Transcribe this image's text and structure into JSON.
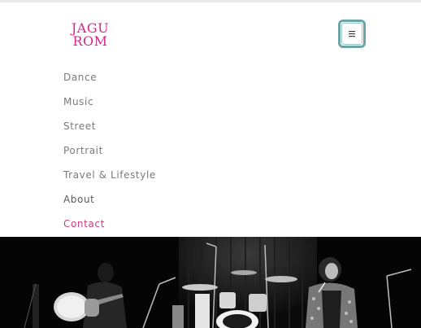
{
  "brand": {
    "logo_line1": "JAGU",
    "logo_line2": "ROM",
    "logo_color": "#d6268b"
  },
  "header": {
    "menu_icon": "hamburger-menu-icon",
    "menu_glyph": "≡",
    "toggle_color": "#6aa7a4"
  },
  "nav": {
    "items": [
      {
        "label": "Dance"
      },
      {
        "label": "Music"
      },
      {
        "label": "Street"
      },
      {
        "label": "Portrait"
      },
      {
        "label": "Travel & Lifestyle"
      },
      {
        "label": "About"
      },
      {
        "label": "Contact"
      }
    ],
    "active_label": "Contact",
    "active_color": "#cc3d7e"
  },
  "hero": {
    "description": "",
    "style": "black-and-white concert photo"
  }
}
